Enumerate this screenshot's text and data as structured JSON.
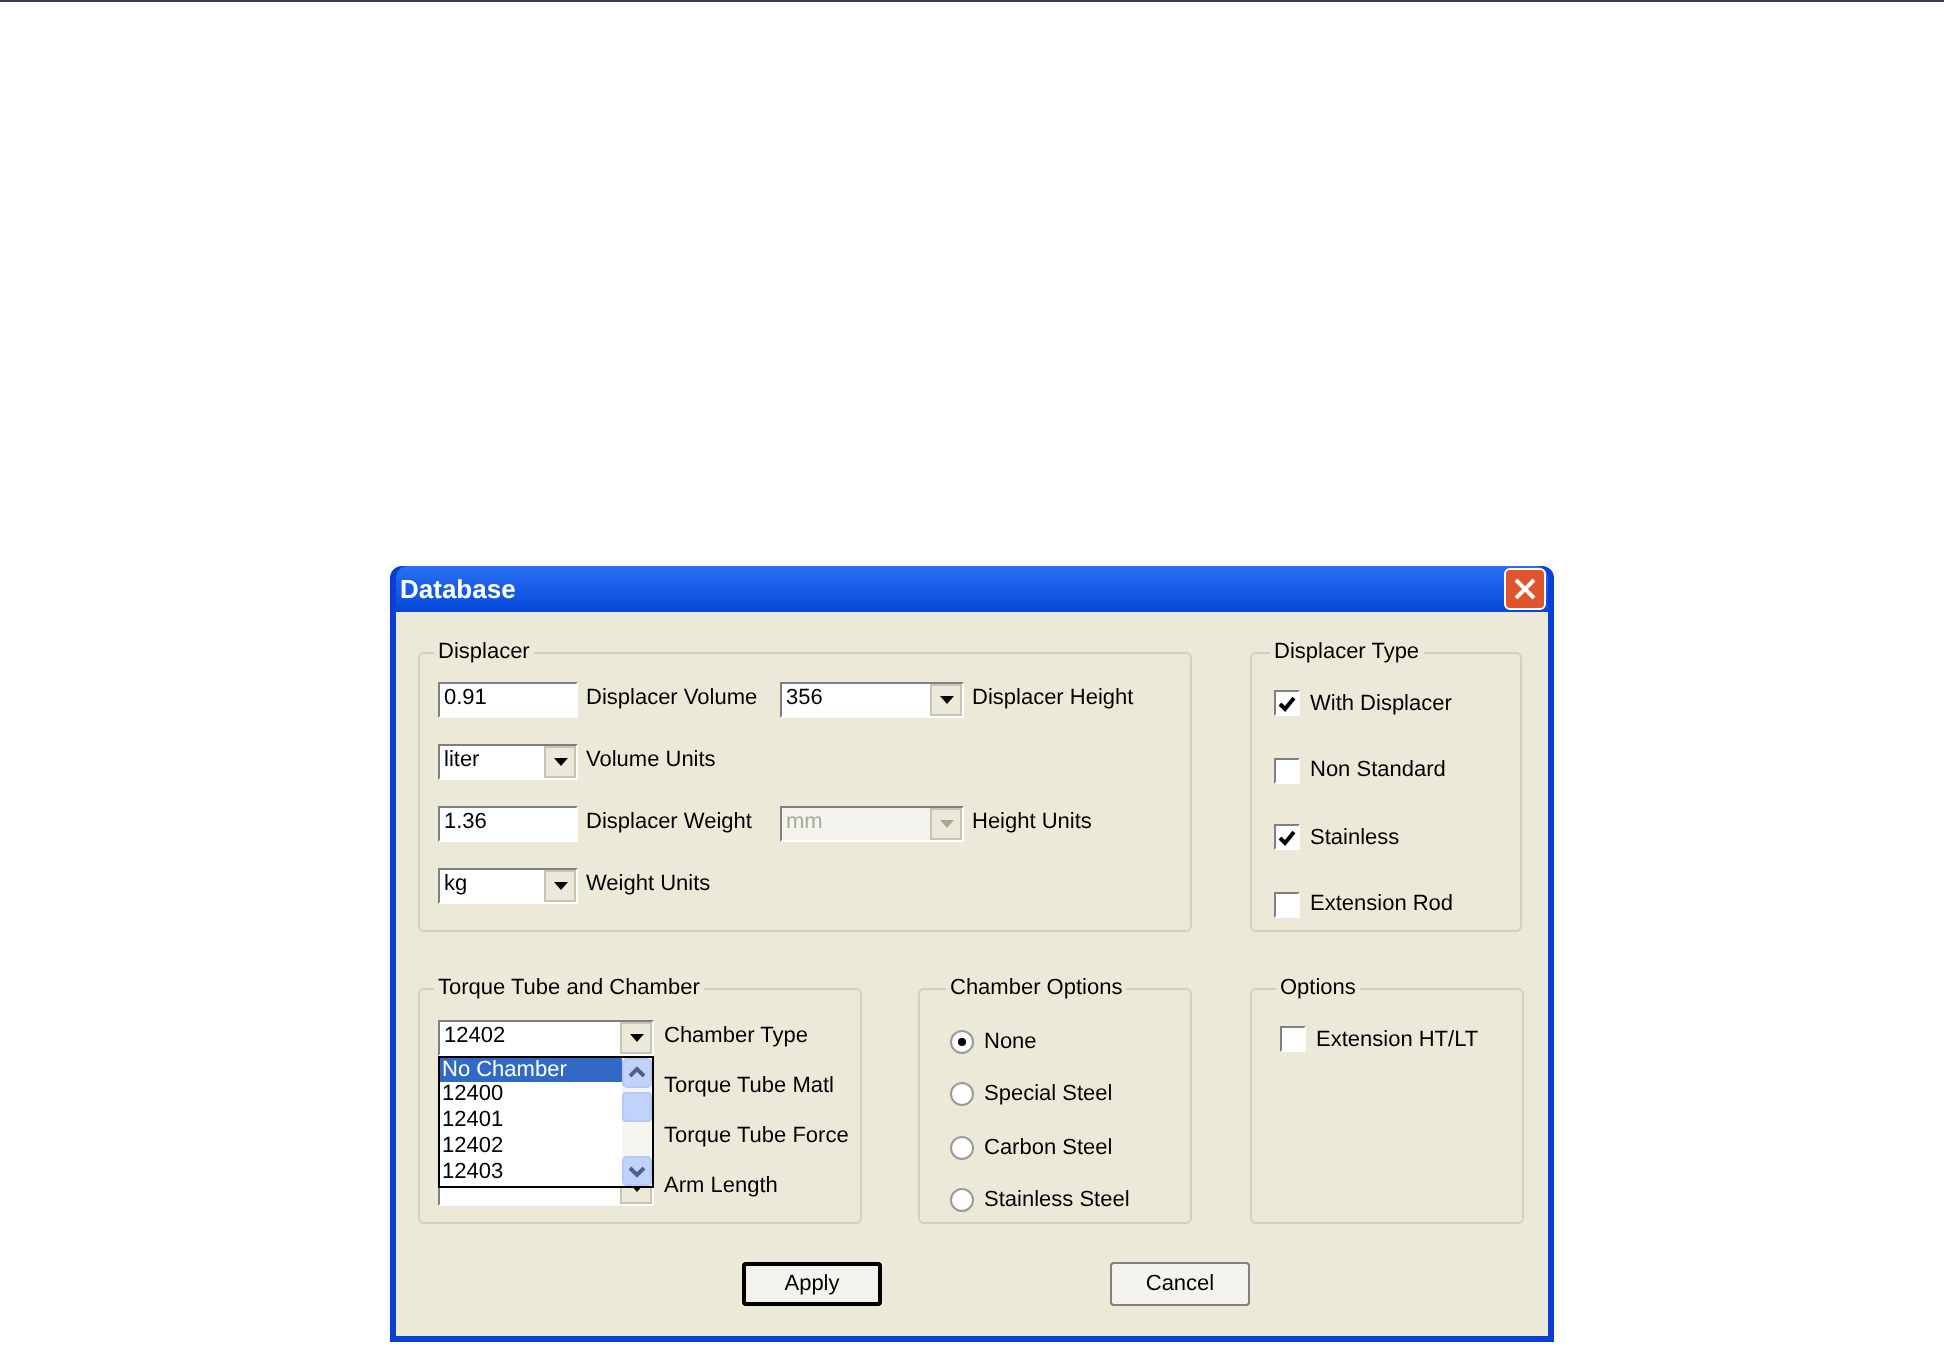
{
  "window": {
    "title": "Database"
  },
  "displacer": {
    "title": "Displacer",
    "rows": [
      [
        {
          "kind": "text",
          "value": "0.91",
          "caption": "Displacer Volume",
          "disabled": false
        },
        {
          "kind": "combo",
          "value": "356",
          "caption": "Displacer Height",
          "disabled": false
        }
      ],
      [
        {
          "kind": "combo",
          "value": "liter",
          "caption": "Volume Units",
          "disabled": false
        }
      ],
      [
        {
          "kind": "text",
          "value": "1.36",
          "caption": "Displacer Weight",
          "disabled": false
        },
        {
          "kind": "combo",
          "value": "mm",
          "caption": "Height Units",
          "disabled": true
        }
      ],
      [
        {
          "kind": "combo",
          "value": "kg",
          "caption": "Weight Units",
          "disabled": false
        }
      ]
    ]
  },
  "displacer_type": {
    "title": "Displacer Type",
    "checkboxes": [
      {
        "label": "With Displacer",
        "checked": true
      },
      {
        "label": "Non Standard",
        "checked": false
      },
      {
        "label": "Stainless",
        "checked": true
      },
      {
        "label": "Extension Rod",
        "checked": false
      }
    ]
  },
  "torque_tube": {
    "title": "Torque Tube and Chamber",
    "rows": [
      {
        "kind": "combo",
        "value": "12402",
        "label": "Chamber Type"
      },
      {
        "kind": "label",
        "label": "Torque Tube Matl"
      },
      {
        "kind": "label",
        "label": "Torque Tube Force"
      },
      {
        "kind": "combo",
        "label": "Arm Length"
      }
    ],
    "dropdown_list": {
      "items": [
        {
          "text": "No Chamber",
          "selected": true
        },
        {
          "text": "12400",
          "selected": false
        },
        {
          "text": "12401",
          "selected": false
        },
        {
          "text": "12402",
          "selected": false
        },
        {
          "text": "12403",
          "selected": false
        }
      ]
    }
  },
  "chamber_options": {
    "title": "Chamber Options",
    "radios": [
      {
        "label": "None",
        "selected": true
      },
      {
        "label": "Special Steel",
        "selected": false
      },
      {
        "label": "Carbon Steel",
        "selected": false
      },
      {
        "label": "Stainless Steel",
        "selected": false
      }
    ]
  },
  "options": {
    "title": "Options",
    "checkboxes": [
      {
        "label": "Extension HT/LT",
        "checked": false
      }
    ]
  },
  "buttons": [
    {
      "label": "Apply",
      "default": true
    },
    {
      "label": "Cancel",
      "default": false
    }
  ]
}
